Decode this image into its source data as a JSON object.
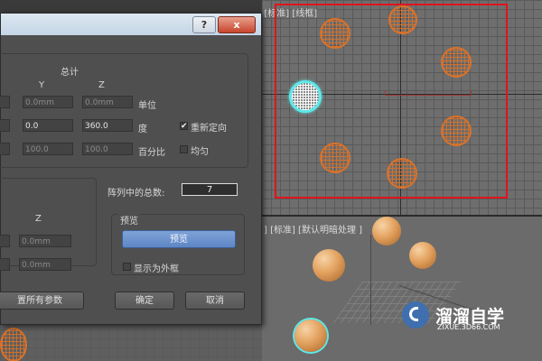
{
  "viewport_top": {
    "label": "[+] [顶] [标准] [线框]"
  },
  "viewport_persp": {
    "label": "] [标准] [默认明暗处理 ]"
  },
  "dialog": {
    "help": "?",
    "close": "x",
    "totals": {
      "heading": "总计",
      "col_y": "Y",
      "col_z": "Z",
      "rows": [
        {
          "y": "0.0mm",
          "z": "0.0mm",
          "unit": "单位"
        },
        {
          "y": "0.0",
          "z": "360.0",
          "unit": "度",
          "option": "重新定向",
          "checked": true
        },
        {
          "y": "100.0",
          "z": "100.0",
          "unit": "百分比",
          "option": "均匀",
          "checked": false
        }
      ]
    },
    "count_label": "阵列中的总数:",
    "count_value": "7",
    "bottom_group": {
      "col_z": "Z",
      "rows": [
        {
          "z": "0.0mm"
        },
        {
          "z": "0.0mm"
        }
      ]
    },
    "preview": {
      "title": "预览",
      "button": "预览",
      "show_box": "显示为外框",
      "show_box_checked": false
    },
    "reset_button": "置所有参数",
    "ok_button": "确定",
    "cancel_button": "取消"
  },
  "watermark": {
    "name": "溜溜自学",
    "url": "ZIXUE.3D66.COM"
  },
  "colors": {
    "selection_box": "#e0141e",
    "sphere_wire": "#d9722a",
    "selected_outline": "#5ee8ea"
  }
}
